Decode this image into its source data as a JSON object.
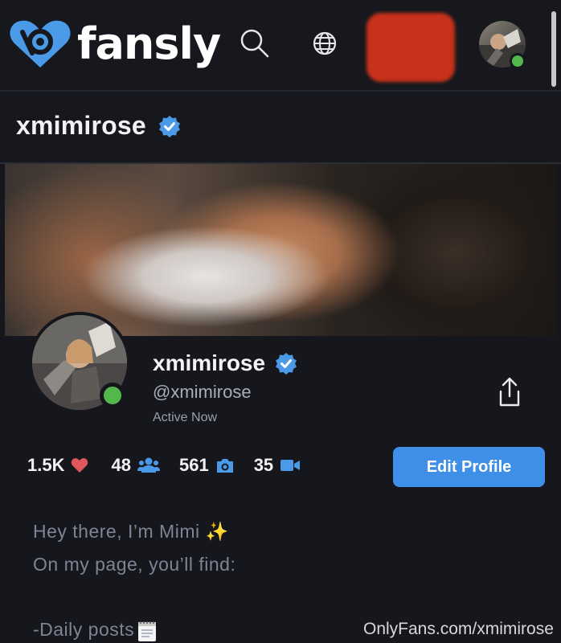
{
  "header": {
    "brand": "fansly",
    "brand_color": "#4b9ae8",
    "icons": [
      "search-icon",
      "globe-icon"
    ]
  },
  "profile": {
    "title": "xmimirose",
    "display_name": "xmimirose",
    "handle": "@xmimirose",
    "status": "Active Now",
    "verified": true,
    "stats": {
      "likes": "1.5K",
      "followers": "48",
      "photos": "561",
      "videos": "35"
    },
    "edit_label": "Edit Profile"
  },
  "bio": {
    "lines": [
      "Hey there, I’m Mimi ✨",
      "On my page, you’ll find:",
      "-Daily posts"
    ]
  },
  "watermark": "OnlyFans.com/xmimirose",
  "colors": {
    "accent": "#3f8fe8",
    "online": "#53b84a",
    "heart": "#e0575b",
    "background": "#15171c"
  }
}
